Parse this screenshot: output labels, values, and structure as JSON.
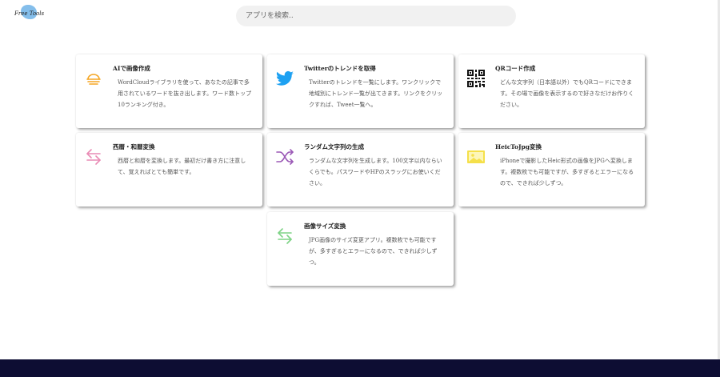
{
  "logo": {
    "text": "Free Tools"
  },
  "search": {
    "placeholder": "アプリを検索.."
  },
  "cards": [
    {
      "title": "AIで画像作成",
      "desc": "WordCloudライブラリを使って、あなたの記事で多用されているワードを抜き出します。ワード数トップ10ランキング付き。",
      "icon": "cloud-sun-icon",
      "color": "#f5a623"
    },
    {
      "title": "Twitterのトレンドを取得",
      "desc": "Twitterのトレンドを一覧にします。ワンクリックで地域別にトレンド一覧が出てきます。リンクをクリックすれば、Tweet一覧へ。",
      "icon": "twitter-icon",
      "color": "#1da1f2"
    },
    {
      "title": "QRコード作成",
      "desc": "どんな文字列（日本語以外）でもQRコードにできます。その場で画像を表示するので好きなだけお作りください。",
      "icon": "qr-code-icon",
      "color": "#111111"
    },
    {
      "title": "西暦・和暦変換",
      "desc": "西暦と和暦を変換します。最初だけ書き方に注意して、覚えればとても簡単です。",
      "icon": "arrows-exchange-icon",
      "color": "#e98bb5"
    },
    {
      "title": "ランダム文字列の生成",
      "desc": "ランダムな文字列を生成します。100文字以内ならいくらでも。パスワードやHPのスラッグにお使いください。",
      "icon": "shuffle-icon",
      "color": "#9b59b6"
    },
    {
      "title": "HeicToJpg変換",
      "desc": "iPhoneで撮影したHeic形式の画像をJPGへ変換します。複数枚でも可能ですが、多すぎるとエラーになるので、できれば少しずつ。",
      "icon": "image-icon",
      "color": "#f5e04a"
    },
    {
      "title": "画像サイズ変換",
      "desc": "JPG画像のサイズ変更アプリ。複数枚でも可能ですが、多すぎるとエラーになるので、できれば少しずつ。",
      "icon": "arrows-exchange-icon",
      "color": "#7ed386"
    }
  ]
}
